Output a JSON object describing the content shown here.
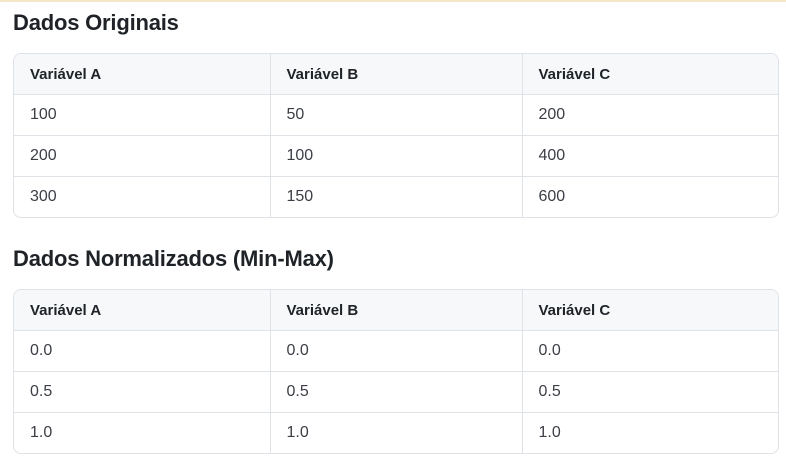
{
  "accent_color": "#f3e7c6",
  "sections": [
    {
      "title": "Dados Originais",
      "columns": [
        "Variável A",
        "Variável B",
        "Variável C"
      ],
      "rows": [
        [
          "100",
          "50",
          "200"
        ],
        [
          "200",
          "100",
          "400"
        ],
        [
          "300",
          "150",
          "600"
        ]
      ]
    },
    {
      "title": "Dados Normalizados (Min-Max)",
      "columns": [
        "Variável A",
        "Variável B",
        "Variável C"
      ],
      "rows": [
        [
          "0.0",
          "0.0",
          "0.0"
        ],
        [
          "0.5",
          "0.5",
          "0.5"
        ],
        [
          "1.0",
          "1.0",
          "1.0"
        ]
      ]
    }
  ]
}
